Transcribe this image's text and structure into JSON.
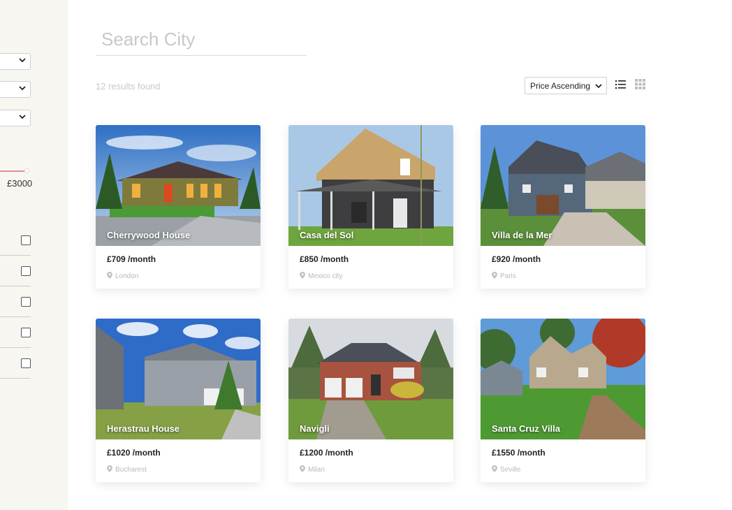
{
  "search": {
    "placeholder": "Search City"
  },
  "results_text": "12 results found",
  "sort": {
    "selected": "Price Ascending"
  },
  "filters": {
    "price_max_label": "£3000"
  },
  "listings": [
    {
      "name": "Cherrywood House",
      "price": "£709 /month",
      "city": "London"
    },
    {
      "name": "Casa del Sol",
      "price": "£850 /month",
      "city": "Mexico city"
    },
    {
      "name": "Villa de la Mer",
      "price": "£920 /month",
      "city": "Paris"
    },
    {
      "name": "Herastrau House",
      "price": "£1020 /month",
      "city": "Bucharest"
    },
    {
      "name": "Navigli",
      "price": "£1200 /month",
      "city": "Milan"
    },
    {
      "name": "Santa Cruz Villa",
      "price": "£1550 /month",
      "city": "Seville"
    }
  ],
  "colors": {
    "accent": "#e58f94",
    "sidebar_bg": "#f7f6f1"
  },
  "icons": [
    "chevron-down-icon",
    "list-view-icon",
    "grid-view-icon",
    "location-pin-icon"
  ]
}
